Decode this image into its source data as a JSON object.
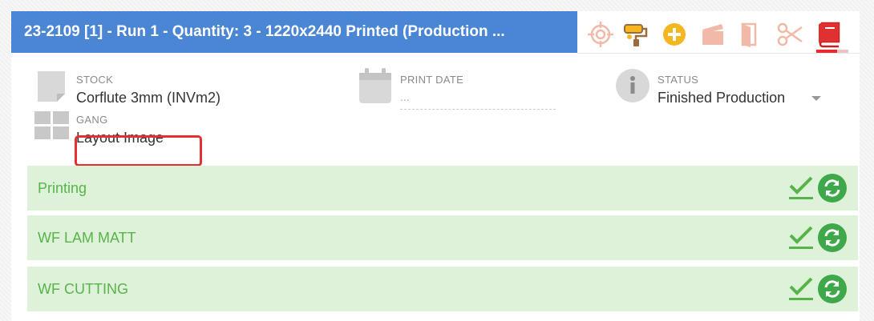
{
  "header": {
    "title": "23-2109 [1] - Run 1 - Quantity: 3 - 1220x2440 Printed (Production ..."
  },
  "toolbar": {
    "icons": [
      "target-icon",
      "paint-roller-icon",
      "add-circle-icon",
      "clapperboard-icon",
      "book-open-icon",
      "scissors-icon",
      "book-icon"
    ]
  },
  "fields": {
    "stock": {
      "label": "STOCK",
      "value": "Corflute 3mm (INVm2)"
    },
    "print_date": {
      "label": "PRINT DATE",
      "value": "..."
    },
    "status": {
      "label": "STATUS",
      "value": "Finished Production"
    },
    "gang": {
      "label": "GANG",
      "value": "Layout Image"
    }
  },
  "stages": [
    {
      "label": "Printing"
    },
    {
      "label": "WF LAM MATT"
    },
    {
      "label": "WF CUTTING"
    }
  ],
  "colors": {
    "header_bg": "#4a86d4",
    "toolbar_icon": "#f3b9a8",
    "toolbar_icon_active": "#e03030",
    "add_icon": "#f4b71f",
    "stage_bg": "#ddf2d8",
    "stage_text": "#58b44a",
    "highlight": "#e53030"
  }
}
